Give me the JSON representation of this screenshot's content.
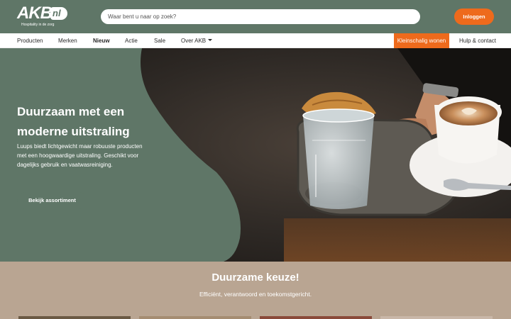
{
  "header": {
    "logo": {
      "main": "AKB",
      "suffix": "nl",
      "tagline": "Hospitality in de zorg"
    },
    "search": {
      "placeholder": "Waar bent u naar op zoek?"
    },
    "login_label": "Inloggen"
  },
  "nav": {
    "items": [
      {
        "label": "Producten"
      },
      {
        "label": "Merken"
      },
      {
        "label": "Nieuw"
      },
      {
        "label": "Actie"
      },
      {
        "label": "Sale"
      },
      {
        "label": "Over AKB"
      }
    ],
    "highlight_label": "Kleinschalig wonen",
    "help_label": "Hulp & contact"
  },
  "hero": {
    "title": "Duurzaam met een moderne uitstraling",
    "text": "Luups biedt lichtgewicht maar robuuste producten met een hoogwaardige uitstraling. Geschikt voor dagelijks gebruik en vaatwasreiniging.",
    "button_label": "Bekijk assortiment"
  },
  "section": {
    "title": "Duurzame keuze!",
    "subtitle": "Efficiënt, verantwoord en toekomstgericht."
  },
  "colors": {
    "brand_green": "#5f7667",
    "accent_orange": "#ee6a1c",
    "section_tan": "#b9a592"
  }
}
